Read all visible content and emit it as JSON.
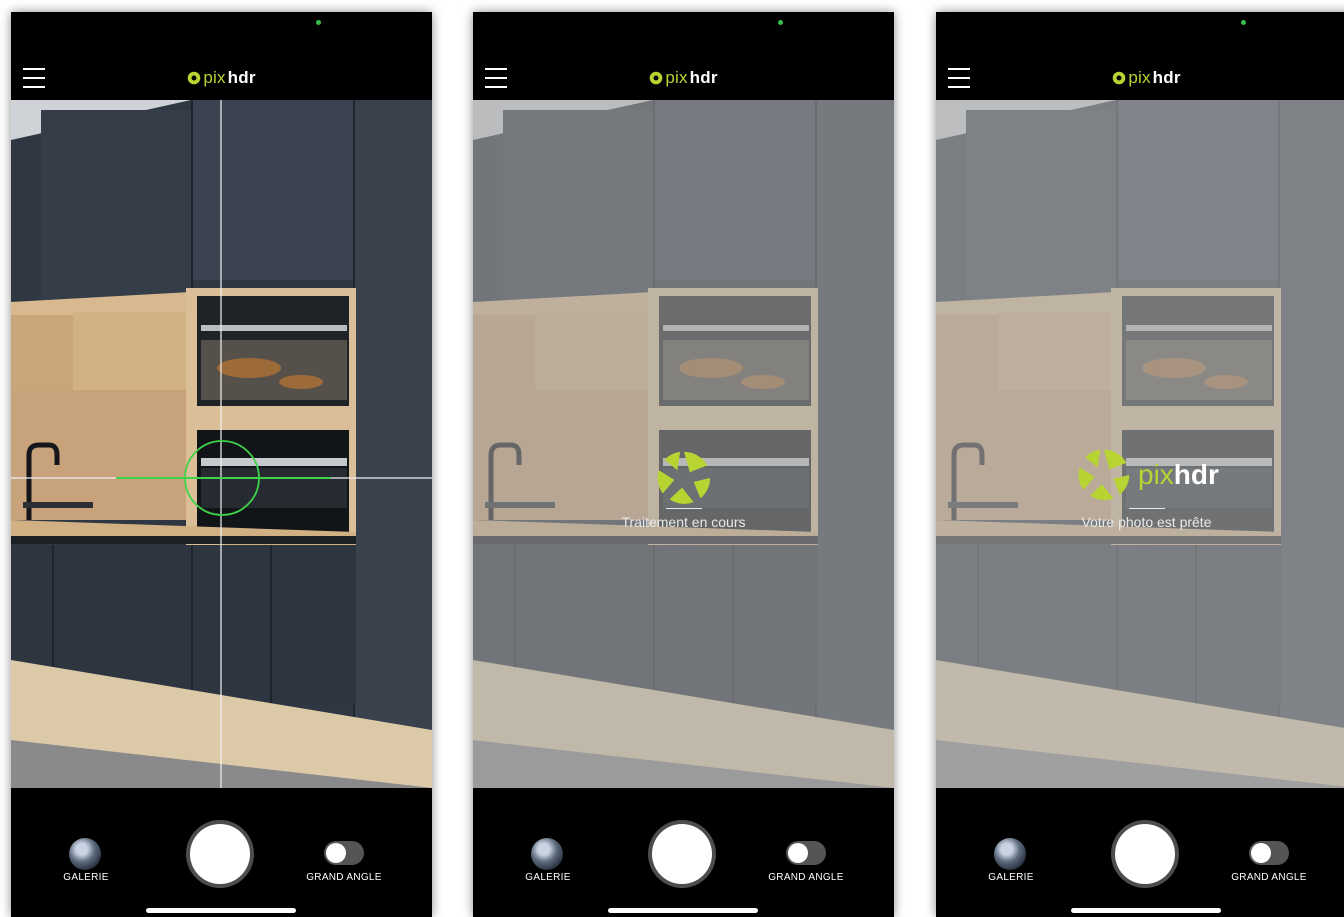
{
  "app": {
    "logo_pix": "pix",
    "logo_hdr": "hdr"
  },
  "colors": {
    "accent": "#b7d433",
    "status_dot": "#36c04a",
    "crosshair": "#3fd34a"
  },
  "controls": {
    "gallery_label": "GALERIE",
    "wide_angle_label": "GRAND ANGLE"
  },
  "screens": [
    {
      "state": "capture"
    },
    {
      "state": "processing",
      "status_text": "Traitement en cours"
    },
    {
      "state": "ready",
      "status_text": "Votre photo est prête",
      "brand_pix": "pix",
      "brand_hdr": "hdr"
    }
  ]
}
